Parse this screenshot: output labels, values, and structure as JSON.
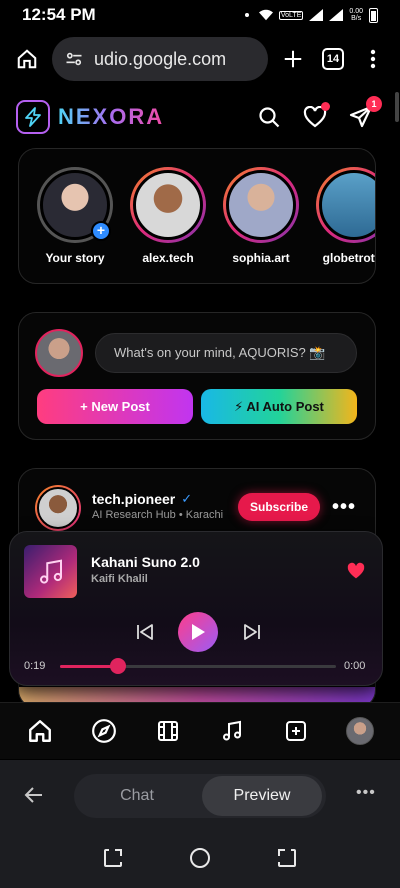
{
  "status_bar": {
    "time": "12:54 PM",
    "volte": "VoLTE",
    "net_speed_top": "0.00",
    "net_speed_bottom": "B/s"
  },
  "browser": {
    "url": "udio.google.com",
    "tab_count": "14"
  },
  "app": {
    "brand": "NEXORA",
    "notifications_badge": "1"
  },
  "stories": [
    {
      "name": "Your story",
      "own": true
    },
    {
      "name": "alex.tech"
    },
    {
      "name": "sophia.art"
    },
    {
      "name": "globetrotte"
    }
  ],
  "composer": {
    "placeholder": "What's on your mind, AQUORIS? 📸",
    "new_post": "+ New Post",
    "ai_post": "⚡ AI Auto Post"
  },
  "post": {
    "author": "tech.pioneer",
    "verified": "✓",
    "subtitle": "AI Research Hub • Karachi",
    "subscribe": "Subscribe",
    "more": "•••"
  },
  "player": {
    "song": "Kahani Suno 2.0",
    "artist": "Kaifi Khalil",
    "current_time": "0:19",
    "end_time": "0:00",
    "progress": 0.21,
    "accent": "#e0245e"
  },
  "bottom_nav": [
    "home-icon",
    "explore-icon",
    "reels-icon",
    "music-icon",
    "create-icon",
    "profile-avatar"
  ],
  "editor_bar": {
    "chat": "Chat",
    "preview": "Preview",
    "more": "•••"
  }
}
